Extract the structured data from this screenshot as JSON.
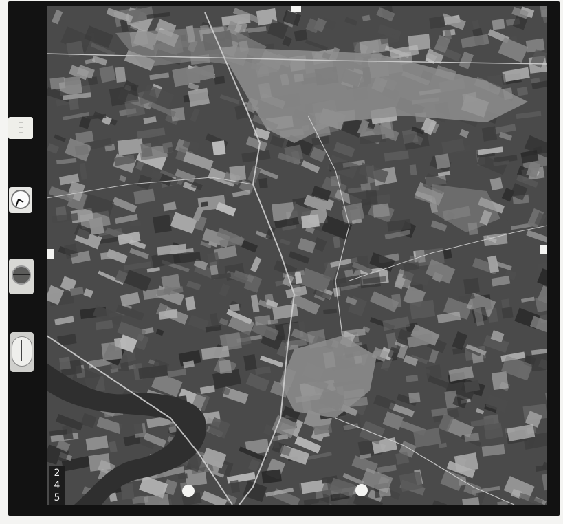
{
  "frame_number": {
    "digit_1": "2",
    "digit_2": "4",
    "digit_3": "5"
  },
  "instrument_strip": {
    "note_card_lines": [
      "…",
      "…",
      "…"
    ],
    "level_label_top": "",
    "level_label_bottom": ""
  },
  "colors": {
    "film_frame": "#121212",
    "paper_margin": "#f4f4f2",
    "river": "#3a3a3a",
    "road": "#cfcfcf",
    "urban": "#9a9a9a"
  },
  "icons": {
    "clock": "clock-icon",
    "level": "level-bubble-icon",
    "altimeter": "altimeter-icon"
  }
}
